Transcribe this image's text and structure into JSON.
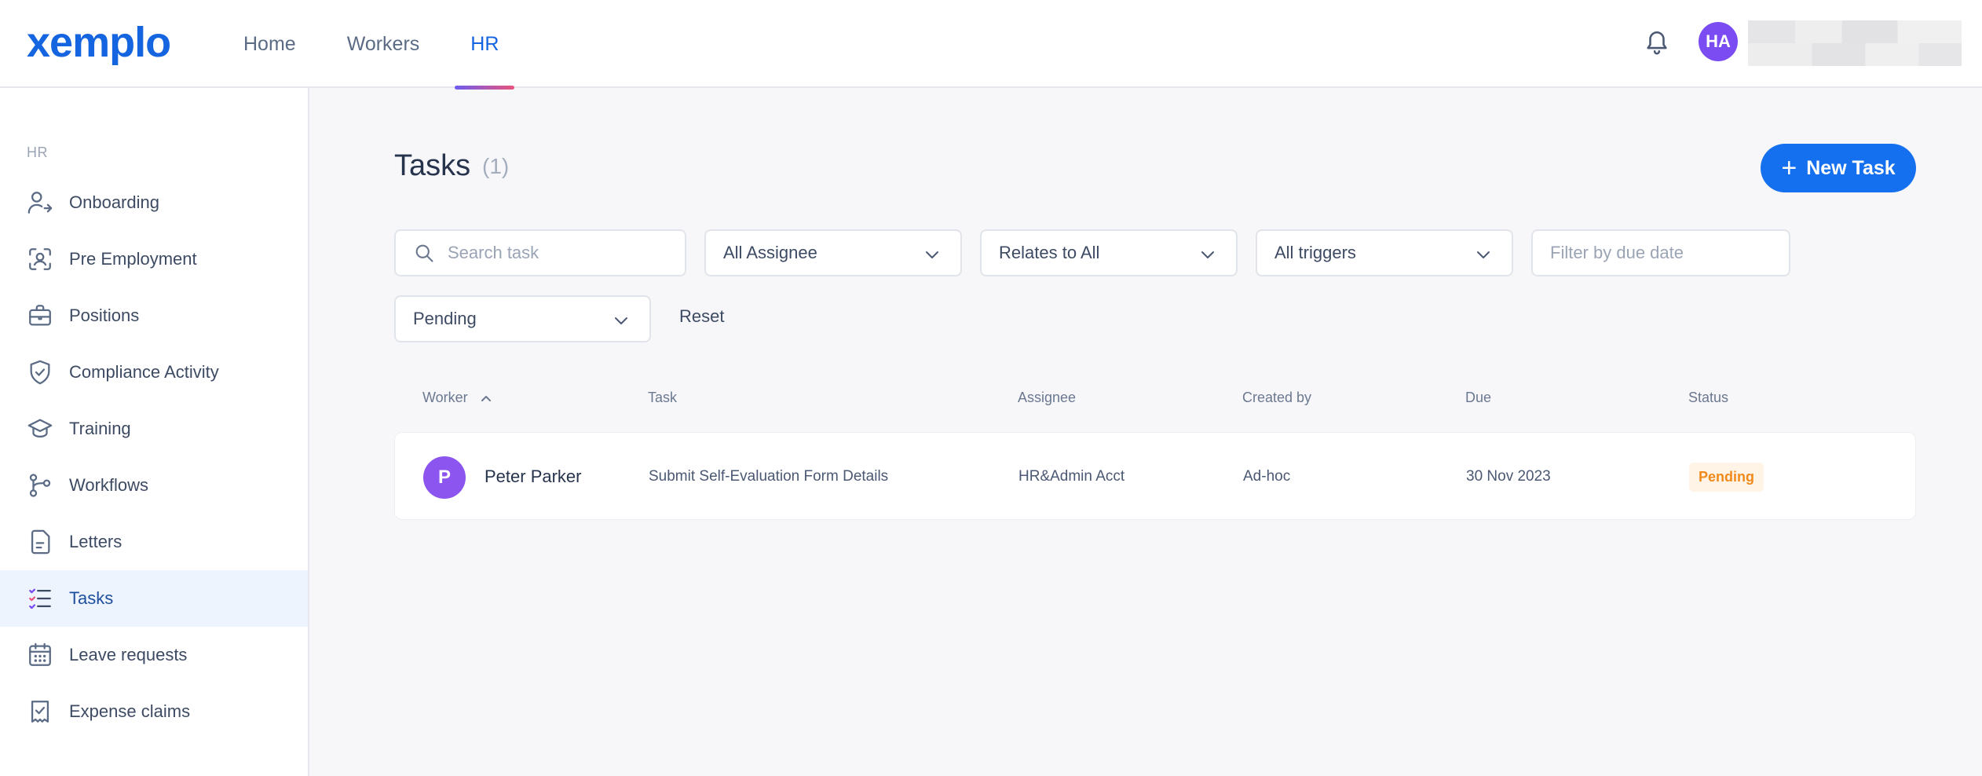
{
  "header": {
    "logo": "xemplo",
    "nav": [
      "Home",
      "Workers",
      "HR"
    ],
    "active_nav": "HR",
    "user_initials": "HA"
  },
  "sidebar": {
    "section": "HR",
    "items": [
      {
        "label": "Onboarding",
        "icon": "user-arrow-icon"
      },
      {
        "label": "Pre Employment",
        "icon": "user-scan-icon"
      },
      {
        "label": "Positions",
        "icon": "briefcase-icon"
      },
      {
        "label": "Compliance Activity",
        "icon": "shield-check-icon"
      },
      {
        "label": "Training",
        "icon": "graduation-cap-icon"
      },
      {
        "label": "Workflows",
        "icon": "workflow-icon"
      },
      {
        "label": "Letters",
        "icon": "document-icon"
      },
      {
        "label": "Tasks",
        "icon": "task-list-icon"
      },
      {
        "label": "Leave requests",
        "icon": "calendar-icon"
      },
      {
        "label": "Expense claims",
        "icon": "receipt-icon"
      }
    ],
    "active_item": "Tasks"
  },
  "main": {
    "title": "Tasks",
    "count": "(1)",
    "new_task_label": "New Task",
    "filters": {
      "search_placeholder": "Search task",
      "assignee": "All Assignee",
      "relates_to": "Relates to All",
      "triggers": "All triggers",
      "due_date_placeholder": "Filter by due date",
      "status": "Pending",
      "reset_label": "Reset"
    },
    "table": {
      "columns": [
        "Worker",
        "Task",
        "Assignee",
        "Created by",
        "Due",
        "Status"
      ],
      "rows": [
        {
          "avatar_initial": "P",
          "worker": "Peter Parker",
          "task": "Submit Self-Evaluation Form Details",
          "assignee": "HR&Admin Acct",
          "created_by": "Ad-hoc",
          "due": "30 Nov 2023",
          "status": "Pending"
        }
      ]
    }
  },
  "colors": {
    "brand": "#1565e0",
    "primary_button": "#1570ef",
    "avatar": "#7a4cf2",
    "pending": "#f08a1c"
  }
}
